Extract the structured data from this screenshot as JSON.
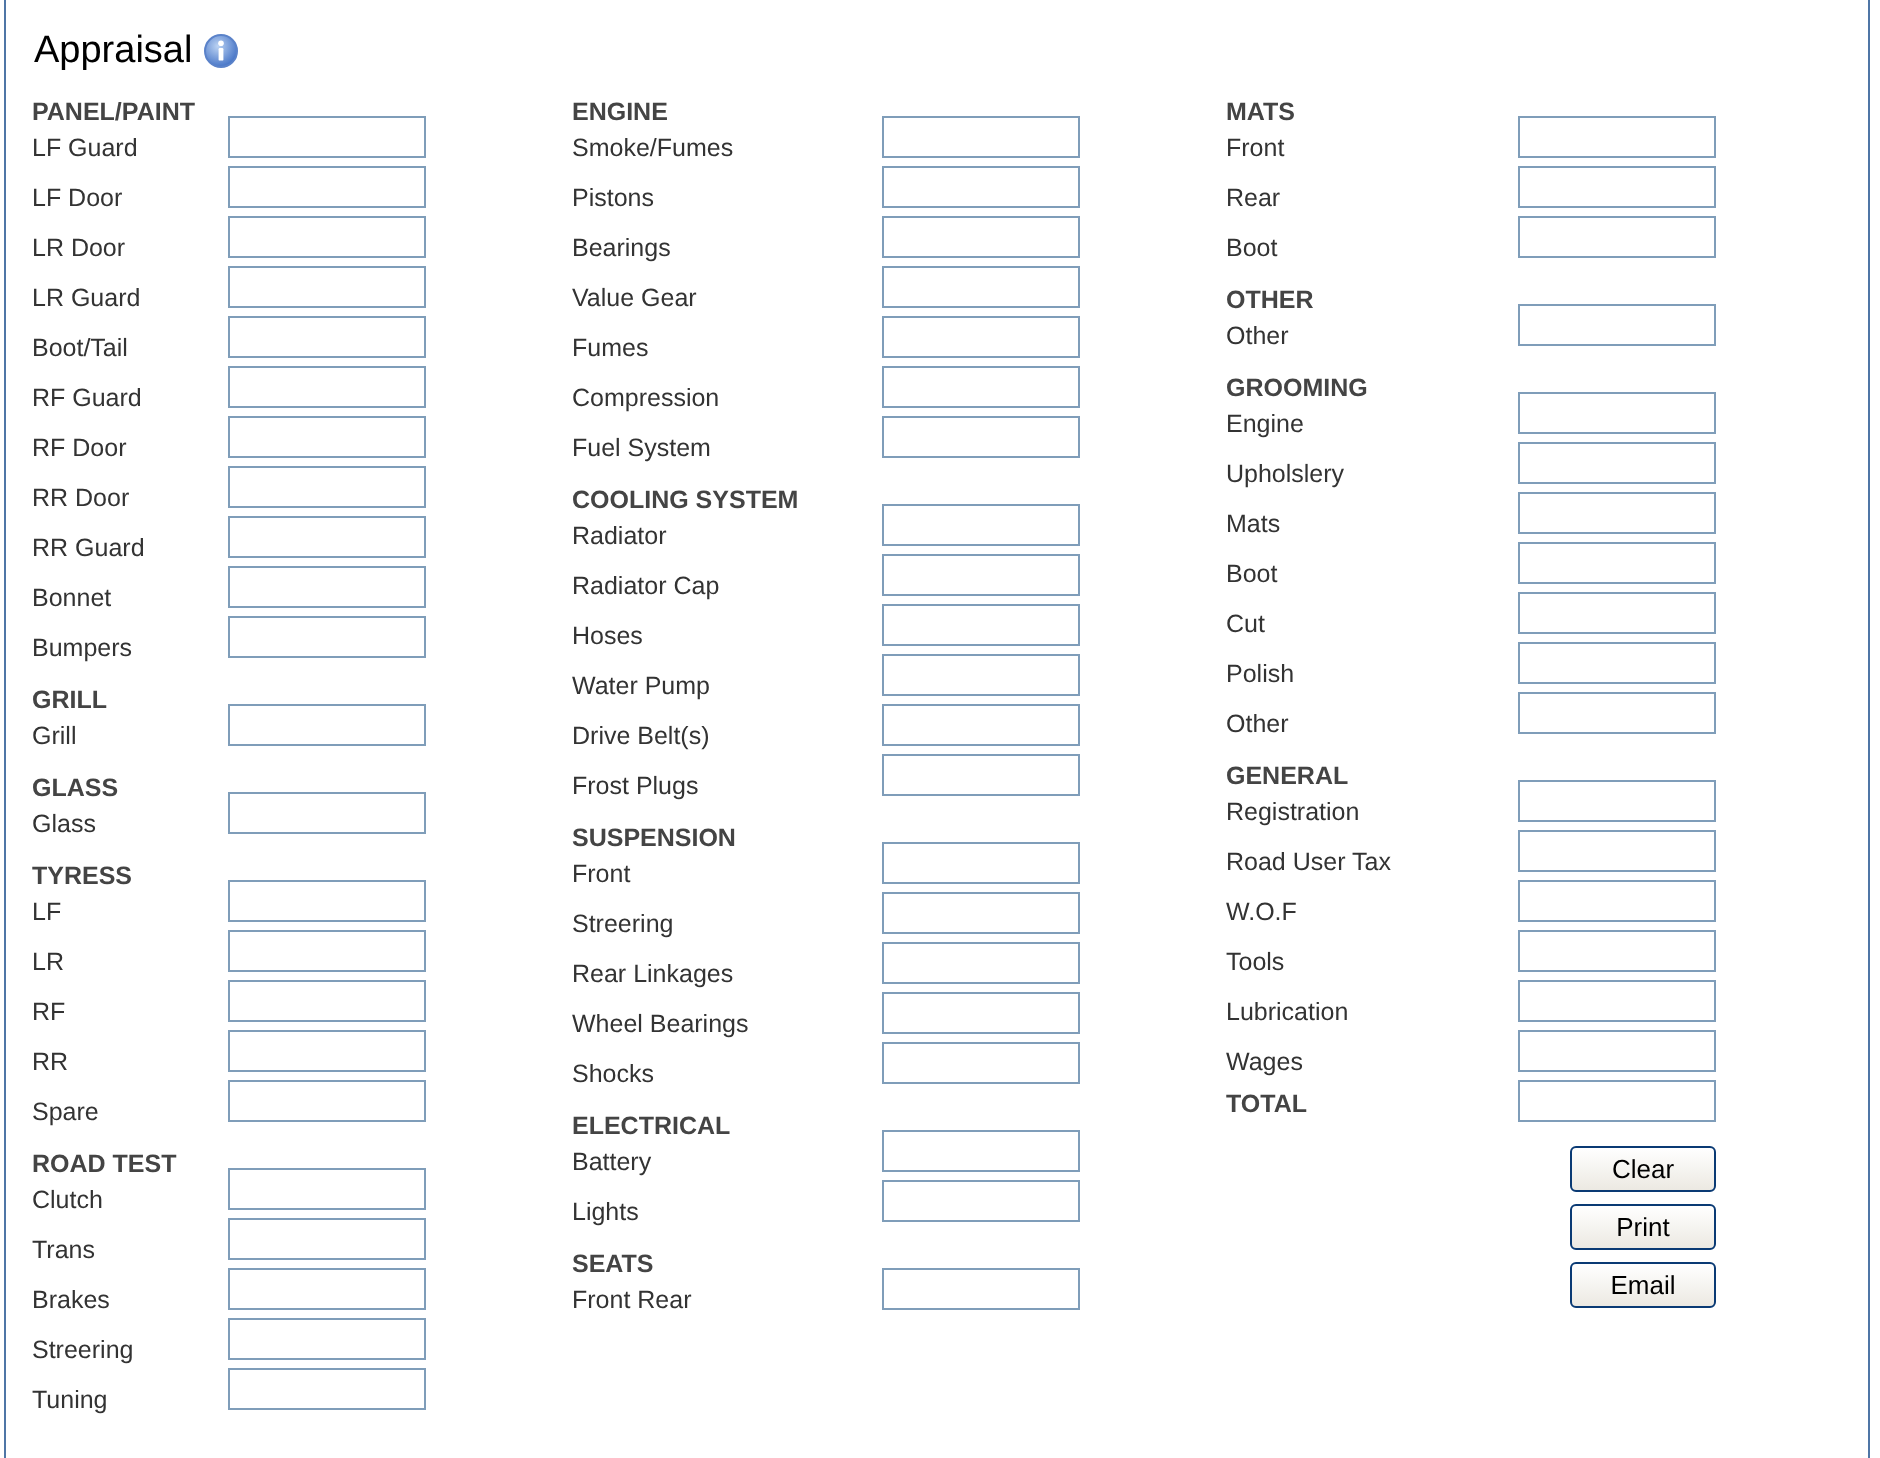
{
  "title": "Appraisal",
  "columns": [
    {
      "sections": [
        {
          "heading": "PANEL/PAINT",
          "fields": [
            "LF Guard",
            "LF Door",
            "LR Door",
            "LR Guard",
            "Boot/Tail",
            "RF Guard",
            "RF Door",
            "RR Door",
            "RR Guard",
            "Bonnet",
            "Bumpers"
          ]
        },
        {
          "heading": "GRILL",
          "fields": [
            "Grill"
          ]
        },
        {
          "heading": "GLASS",
          "fields": [
            "Glass"
          ]
        },
        {
          "heading": "TYRESS",
          "fields": [
            "LF",
            "LR",
            "RF",
            "RR",
            "Spare"
          ]
        },
        {
          "heading": "ROAD TEST",
          "fields": [
            "Clutch",
            "Trans",
            "Brakes",
            "Streering",
            "Tuning"
          ]
        }
      ]
    },
    {
      "sections": [
        {
          "heading": "ENGINE",
          "fields": [
            "Smoke/Fumes",
            "Pistons",
            "Bearings",
            "Value Gear",
            "Fumes",
            "Compression",
            "Fuel System"
          ]
        },
        {
          "heading": "COOLING SYSTEM",
          "fields": [
            "Radiator",
            "Radiator Cap",
            "Hoses",
            "Water Pump",
            "Drive Belt(s)",
            "Frost Plugs"
          ]
        },
        {
          "heading": "SUSPENSION",
          "fields": [
            "Front",
            "Streering",
            "Rear Linkages",
            "Wheel Bearings",
            "Shocks"
          ]
        },
        {
          "heading": "ELECTRICAL",
          "fields": [
            "Battery",
            "Lights"
          ]
        },
        {
          "heading": "SEATS",
          "fields": [
            "Front Rear"
          ]
        }
      ]
    },
    {
      "sections": [
        {
          "heading": "MATS",
          "fields": [
            "Front",
            "Rear",
            "Boot"
          ]
        },
        {
          "heading": "OTHER",
          "fields": [
            "Other"
          ]
        },
        {
          "heading": "GROOMING",
          "fields": [
            "Engine",
            "Upholslery",
            "Mats",
            "Boot",
            "Cut",
            "Polish",
            "Other"
          ]
        },
        {
          "heading": "GENERAL",
          "fields": [
            "Registration",
            "Road User Tax",
            "W.O.F",
            "Tools",
            "Lubrication",
            "Wages"
          ]
        }
      ],
      "total": "TOTAL",
      "buttons": [
        "Clear",
        "Print",
        "Email"
      ]
    }
  ]
}
